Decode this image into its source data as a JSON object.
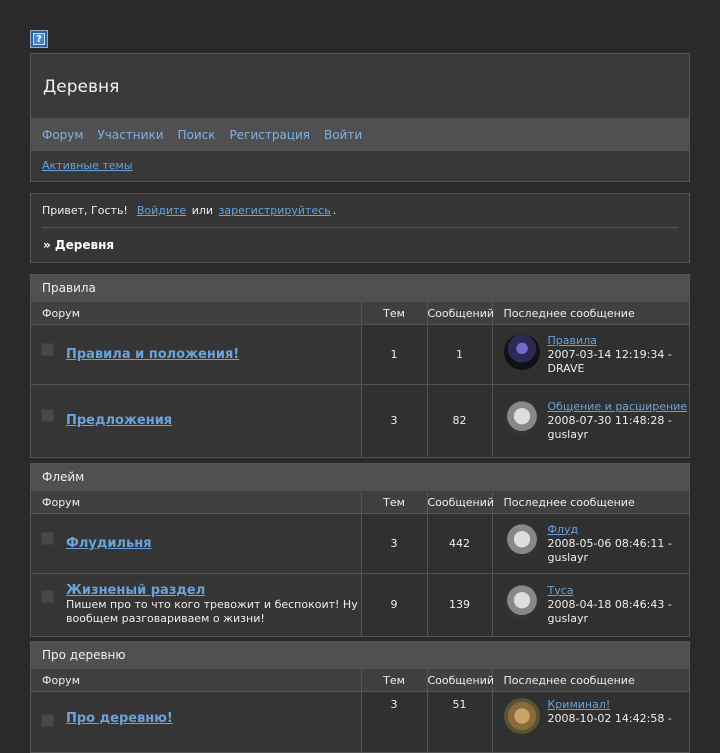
{
  "header": {
    "title": "Деревня",
    "nav": [
      "Форум",
      "Участники",
      "Поиск",
      "Регистрация",
      "Войти"
    ],
    "subnav_link": "Активные темы"
  },
  "welcome": {
    "hello": "Привет, Гость!",
    "login": "Войдите",
    "or": "или",
    "register": "зарегистрируйтесь",
    "period": ".",
    "breadcrumb": "» Деревня"
  },
  "columns": {
    "forum": "Форум",
    "topics": "Тем",
    "posts": "Сообщений",
    "last": "Последнее сообщение"
  },
  "categories": [
    {
      "title": "Правила",
      "forums": [
        {
          "name": "Правила и положения!",
          "topics": "1",
          "posts": "1",
          "last_title": "Правила",
          "last_date": "2007-03-14 12:19:34 -",
          "last_user": "DRAVE"
        },
        {
          "name": "Предложения",
          "topics": "3",
          "posts": "82",
          "last_title": "Общение и расширение",
          "last_date": "2008-07-30 11:48:28 -",
          "last_user": "guslayr"
        }
      ]
    },
    {
      "title": "Флейм",
      "forums": [
        {
          "name": "Флудильня",
          "topics": "3",
          "posts": "442",
          "last_title": "Флуд",
          "last_date": "2008-05-06 08:46:11 -",
          "last_user": "guslayr"
        },
        {
          "name": "Жизненый раздел",
          "desc": "Пишем про то что кого тревожит и беспокоит! Ну вообщем разговариваем о жизни!",
          "topics": "9",
          "posts": "139",
          "last_title": "Туса",
          "last_date": "2008-04-18 08:46:43 -",
          "last_user": "guslayr"
        }
      ]
    },
    {
      "title": "Про деревню",
      "forums": [
        {
          "name": "Про деревню!",
          "topics": "3",
          "posts": "51",
          "last_title": "Криминал!",
          "last_date": "2008-10-02 14:42:58 -",
          "last_user": ""
        }
      ]
    }
  ]
}
